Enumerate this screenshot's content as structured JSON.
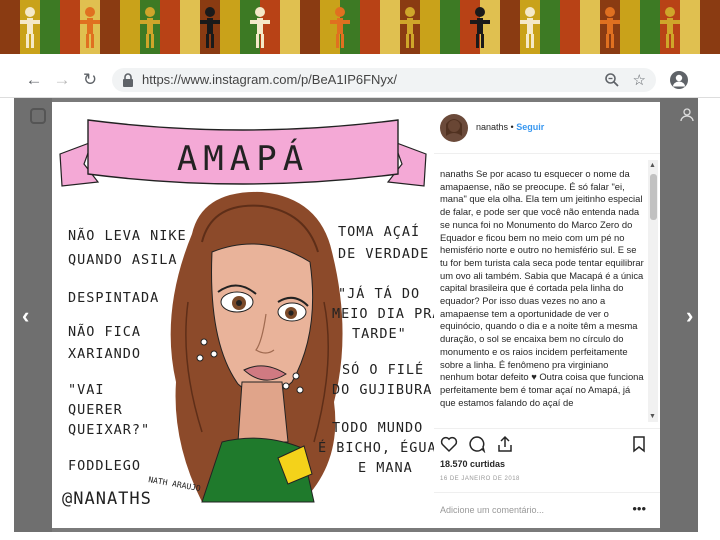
{
  "browser": {
    "url": "https://www.instagram.com/p/BeA1IP6FNyx/"
  },
  "post": {
    "username": "nanaths",
    "separator": "•",
    "follow_label": "Seguir",
    "caption": "nanaths Se por acaso tu esquecer o nome da amapaense, não se preocupe. É só falar \"ei, mana\" que ela olha. Ela tem um jeitinho especial de falar, e pode ser que você não entenda nada se nunca foi no Monumento do Marco Zero do Equador e ficou bem no meio com um pé no hemisfério norte e outro no hemisfério sul. E se tu for bem turista cala seca pode tentar equilibrar um ovo ali também. Sabia que Macapá é a única capital brasileira que é cortada pela linha do equador? Por isso duas vezes no ano a amapaense tem a oportunidade de ver o equinócio, quando o dia e a noite têm a mesma duração, o sol se encaixa bem no círculo do monumento e os raios incidem perfeitamente sobre a linha. É fenômeno pra virginiano nenhum botar defeito ♥ Outra coisa que funciona perfeitamente bem é tomar açaí no Amapá, já que estamos falando do açaí de",
    "likes": "18.570 curtidas",
    "date": "16 DE JANEIRO DE 2018",
    "comment_placeholder": "Adicione um comentário...",
    "more_label": "•••"
  },
  "illustration": {
    "title": "AMAPÁ",
    "left_phrases": [
      "NÃO LEVA NIKE",
      "QUANDO ASILA",
      "DESPINTADA",
      "NÃO FICA",
      "XARIANDO",
      "\"VAI",
      "QUERER",
      "QUEIXAR?\"",
      "FODDLEGO"
    ],
    "right_phrases": [
      "TOMA AÇAÍ",
      "DE VERDADE",
      "\"JÁ TÁ DO",
      "MEIO DIA PRA",
      "TARDE\"",
      "SÓ O FILÉ",
      "DO GUJIBURA",
      "TODO MUNDO",
      "É BICHO, ÉGUA",
      "E MANA"
    ],
    "handle": "@NANATHS",
    "signature": "NATH ARAUJO"
  },
  "colors": {
    "ribbon": "#f4a9d6",
    "hair": "#8c4a2a",
    "skin": "#e9b39a",
    "follow": "#3897f0",
    "overlay": "#7a7a7a"
  },
  "icons": [
    "back-icon",
    "forward-icon",
    "reload-icon",
    "lock-icon",
    "zoom-icon",
    "star-icon",
    "profile-icon",
    "instagram-icon",
    "heart-icon",
    "comment-icon",
    "share-icon",
    "bookmark-icon",
    "chevron-left-icon",
    "chevron-right-icon"
  ]
}
